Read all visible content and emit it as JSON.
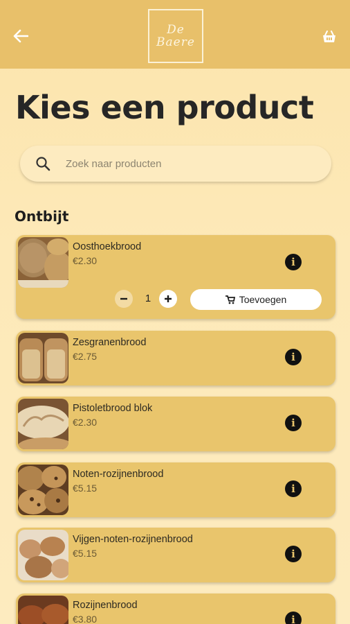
{
  "header": {
    "logo_line1": "De",
    "logo_line2": "Baere",
    "back_icon": "arrow-left-icon",
    "cart_icon": "basket-icon"
  },
  "page_title": "Kies een product",
  "search": {
    "placeholder": "Zoek naar producten",
    "icon": "search-icon"
  },
  "section_title": "Ontbijt",
  "products": [
    {
      "name": "Oosthoekbrood",
      "price": "€2.30",
      "expanded": true,
      "quantity": "1",
      "add_label": "Toevoegen"
    },
    {
      "name": "Zesgranenbrood",
      "price": "€2.75"
    },
    {
      "name": "Pistoletbrood blok",
      "price": "€2.30"
    },
    {
      "name": "Noten-rozijnenbrood",
      "price": "€5.15"
    },
    {
      "name": "Vijgen-noten-rozijnenbrood",
      "price": "€5.15"
    },
    {
      "name": "Rozijnenbrood",
      "price": "€3.80"
    }
  ],
  "colors": {
    "appbar": "#e8c06a",
    "card": "#e9c56c",
    "background": "#fce4ac"
  }
}
